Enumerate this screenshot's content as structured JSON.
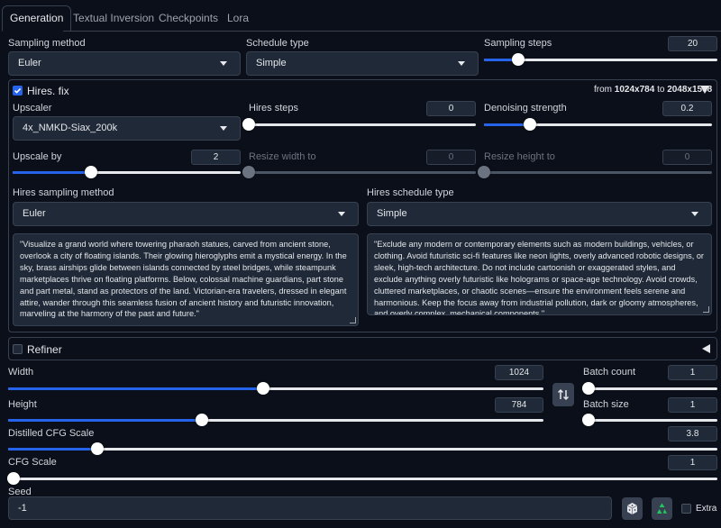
{
  "tabs": [
    "Generation",
    "Textual Inversion",
    "Checkpoints",
    "Lora"
  ],
  "sampling": {
    "method_label": "Sampling method",
    "method_value": "Euler",
    "schedule_label": "Schedule type",
    "schedule_value": "Simple",
    "steps_label": "Sampling steps",
    "steps_value": "20",
    "steps_fraction": 0.146
  },
  "hires": {
    "label": "Hires. fix",
    "checked": true,
    "from_prefix": "from",
    "from_size": "1024x784",
    "to_prefix": "to",
    "to_size": "2048x1568",
    "upscaler_label": "Upscaler",
    "upscaler_value": "4x_NMKD-Siax_200k",
    "steps_label": "Hires steps",
    "steps_value": "0",
    "steps_fraction": 0.0,
    "denoise_label": "Denoising strength",
    "denoise_value": "0.2",
    "denoise_fraction": 0.2,
    "upscale_by_label": "Upscale by",
    "upscale_by_value": "2",
    "upscale_by_fraction": 0.343,
    "width_label": "Resize width to",
    "width_value": "0",
    "width_fraction": 0.0,
    "height_label": "Resize height to",
    "height_value": "0",
    "height_fraction": 0.0,
    "sampling_method_label": "Hires sampling method",
    "sampling_method_value": "Euler",
    "schedule_label": "Hires schedule type",
    "schedule_value": "Simple",
    "prompt": "\"Visualize a grand world where towering pharaoh statues, carved from ancient stone, overlook a city of floating islands. Their glowing hieroglyphs emit a mystical energy. In the sky, brass airships glide between islands connected by steel bridges, while steampunk marketplaces thrive on floating platforms. Below, colossal machine guardians, part stone and part metal, stand as protectors of the land. Victorian-era travelers, dressed in elegant attire, wander through this seamless fusion of ancient history and futuristic innovation, marveling at the harmony of the past and future.\"",
    "negative_prompt": "\"Exclude any modern or contemporary elements such as modern buildings, vehicles, or clothing. Avoid futuristic sci-fi features like neon lights, overly advanced robotic designs, or sleek, high-tech architecture. Do not include cartoonish or exaggerated styles, and exclude anything overly futuristic like holograms or space-age technology. Avoid crowds, cluttered marketplaces, or chaotic scenes—ensure the environment feels serene and harmonious. Keep the focus away from industrial pollution, dark or gloomy atmospheres, and overly complex, mechanical components.\""
  },
  "refiner": {
    "label": "Refiner",
    "checked": false
  },
  "size": {
    "width_label": "Width",
    "width_value": "1024",
    "width_fraction": 0.477,
    "height_label": "Height",
    "height_value": "784",
    "height_fraction": 0.362,
    "batch_count_label": "Batch count",
    "batch_count_value": "1",
    "batch_count_fraction": 0.0,
    "batch_size_label": "Batch size",
    "batch_size_value": "1",
    "batch_size_fraction": 0.0
  },
  "cfg": {
    "distilled_label": "Distilled CFG Scale",
    "distilled_value": "3.8",
    "distilled_fraction": 0.126,
    "cfg_label": "CFG Scale",
    "cfg_value": "1",
    "cfg_fraction": 0.0
  },
  "seed": {
    "label": "Seed",
    "value": "-1",
    "extra_label": "Extra"
  },
  "colors": {
    "accent": "#2563eb",
    "background": "#0b0f19",
    "input": "#1f2937",
    "border": "#374151",
    "recycle": "#22c55e"
  },
  "icons": [
    "swap-icon",
    "dice-icon",
    "recycle-icon",
    "caret-down-icon",
    "caret-left-icon"
  ]
}
